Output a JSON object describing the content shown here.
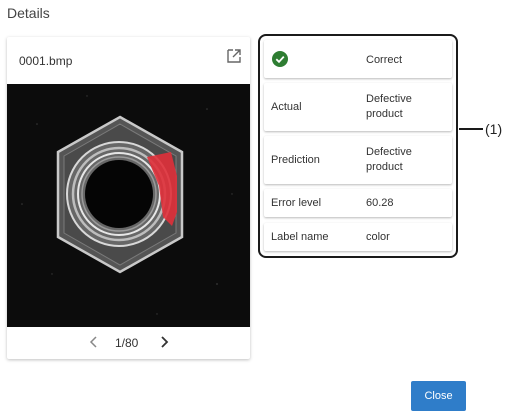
{
  "dialog": {
    "title": "Details",
    "close_label": "Close"
  },
  "image_card": {
    "filename": "0001.bmp",
    "open_external_icon": "open-external-icon",
    "pager": {
      "text": "1/80",
      "prev_icon": "chevron-left-icon",
      "next_icon": "chevron-right-icon"
    }
  },
  "info": {
    "status_icon": "check-circle-icon",
    "status_color": "#2e7d32",
    "status": "Correct",
    "rows": [
      {
        "label": "Actual",
        "value_line1": "Defective",
        "value_line2": "product"
      },
      {
        "label": "Prediction",
        "value_line1": "Defective",
        "value_line2": "product"
      },
      {
        "label": "Error level",
        "value": "60.28"
      },
      {
        "label": "Label name",
        "value": "color"
      }
    ]
  },
  "callout": {
    "label": "(1)"
  },
  "colors": {
    "accent": "#2f7dc9",
    "defect_highlight": "#e0303a"
  }
}
